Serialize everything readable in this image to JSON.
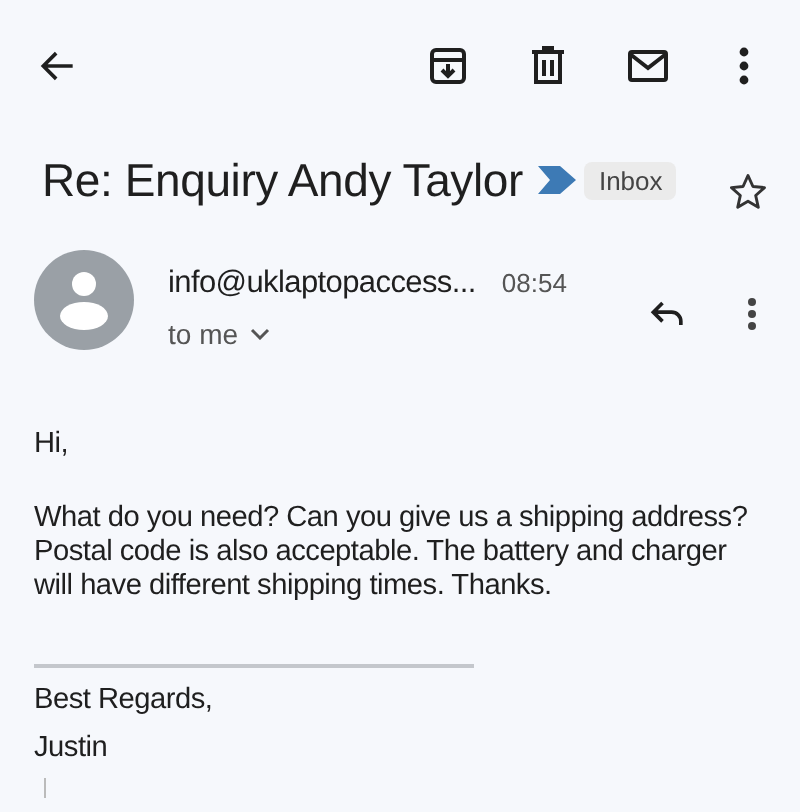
{
  "subject": "Re: Enquiry Andy Taylor",
  "label": {
    "text": "Inbox",
    "color": "#3d7ab5"
  },
  "starred": false,
  "message": {
    "sender": "info@uklaptopaccess...",
    "time": "08:54",
    "recipient": "to me"
  },
  "body": {
    "greeting": "Hi,",
    "paragraph": [
      "What do you need? Can you give us a shipping address?",
      "Postal code is also acceptable. The battery and charger",
      "will have different shipping times. Thanks."
    ],
    "signature": [
      "Best Regards,",
      "Justin"
    ]
  }
}
